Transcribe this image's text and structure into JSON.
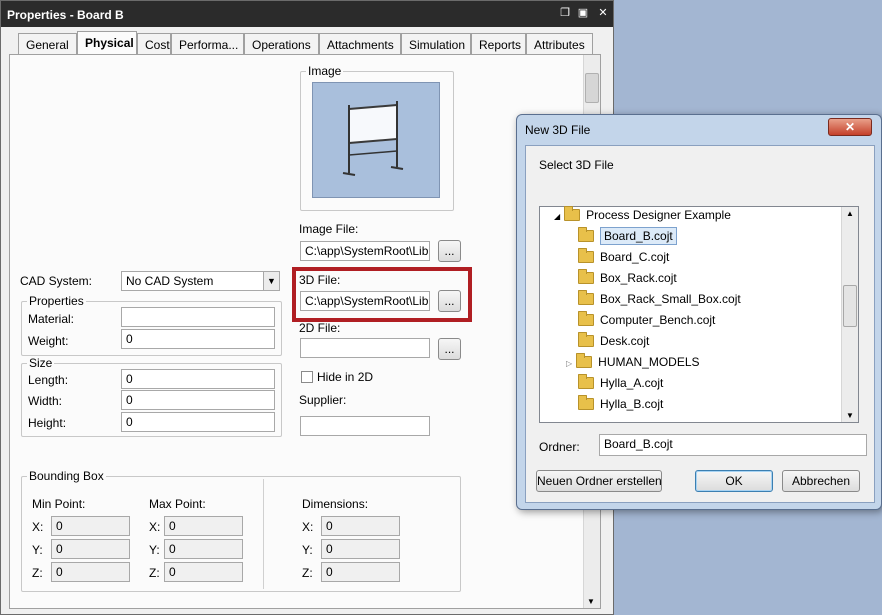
{
  "properties_window": {
    "title": "Properties  - Board B",
    "tabs": [
      "General",
      "Physical",
      "Cost",
      "Performa...",
      "Operations",
      "Attachments",
      "Simulation",
      "Reports",
      "Attributes"
    ],
    "active_tab": "Physical",
    "cad_system_label": "CAD System:",
    "cad_system_value": "No CAD System",
    "properties_group": "Properties",
    "material_label": "Material:",
    "material_value": "",
    "weight_label": "Weight:",
    "weight_value": "0",
    "size_group": "Size",
    "length_label": "Length:",
    "length_value": "0",
    "width_label": "Width:",
    "width_value": "0",
    "height_label": "Height:",
    "height_value": "0",
    "image_group": "Image",
    "image_file_label": "Image File:",
    "image_file_value": "C:\\app\\SystemRoot\\Libra",
    "threed_file_label": "3D File:",
    "threed_file_value": "C:\\app\\SystemRoot\\Libra",
    "twod_file_label": "2D File:",
    "twod_file_value": "",
    "browse_label": "...",
    "hide_in_2d_label": "Hide in 2D",
    "supplier_label": "Supplier:",
    "supplier_value": "",
    "bbox_group": "Bounding Box",
    "min_point_label": "Min Point:",
    "max_point_label": "Max Point:",
    "dimensions_label": "Dimensions:",
    "x_label": "X:",
    "y_label": "Y:",
    "z_label": "Z:",
    "min": {
      "x": "0",
      "y": "0",
      "z": "0"
    },
    "max": {
      "x": "0",
      "y": "0",
      "z": "0"
    },
    "dim": {
      "x": "0",
      "y": "0",
      "z": "0"
    },
    "highlight_color": "#b01e23"
  },
  "dialog": {
    "title": "New 3D File",
    "prompt": "Select 3D File",
    "tree_root": "Process Designer Example",
    "items": [
      "Board_B.cojt",
      "Board_C.cojt",
      "Box_Rack.cojt",
      "Box_Rack_Small_Box.cojt",
      "Computer_Bench.cojt",
      "Desk.cojt",
      "HUMAN_MODELS",
      "Hylla_A.cojt",
      "Hylla_B.cojt"
    ],
    "selected_item": "Board_B.cojt",
    "folder_label": "Ordner:",
    "folder_value": "Board_B.cojt",
    "new_folder_button": "Neuen Ordner erstellen",
    "ok_button": "OK",
    "cancel_button": "Abbrechen"
  }
}
